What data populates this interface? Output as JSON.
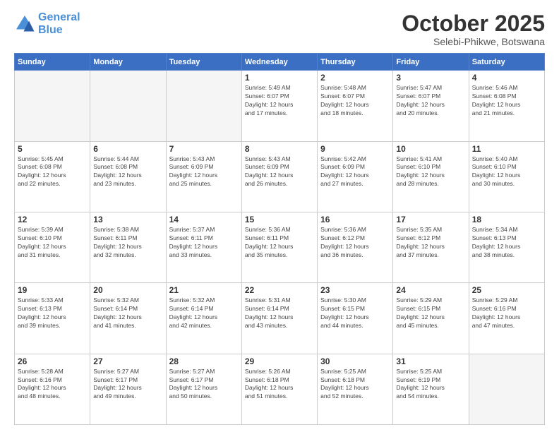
{
  "logo": {
    "line1": "General",
    "line2": "Blue"
  },
  "header": {
    "month": "October 2025",
    "location": "Selebi-Phikwe, Botswana"
  },
  "weekdays": [
    "Sunday",
    "Monday",
    "Tuesday",
    "Wednesday",
    "Thursday",
    "Friday",
    "Saturday"
  ],
  "weeks": [
    [
      {
        "day": "",
        "info": ""
      },
      {
        "day": "",
        "info": ""
      },
      {
        "day": "",
        "info": ""
      },
      {
        "day": "1",
        "info": "Sunrise: 5:49 AM\nSunset: 6:07 PM\nDaylight: 12 hours\nand 17 minutes."
      },
      {
        "day": "2",
        "info": "Sunrise: 5:48 AM\nSunset: 6:07 PM\nDaylight: 12 hours\nand 18 minutes."
      },
      {
        "day": "3",
        "info": "Sunrise: 5:47 AM\nSunset: 6:07 PM\nDaylight: 12 hours\nand 20 minutes."
      },
      {
        "day": "4",
        "info": "Sunrise: 5:46 AM\nSunset: 6:08 PM\nDaylight: 12 hours\nand 21 minutes."
      }
    ],
    [
      {
        "day": "5",
        "info": "Sunrise: 5:45 AM\nSunset: 6:08 PM\nDaylight: 12 hours\nand 22 minutes."
      },
      {
        "day": "6",
        "info": "Sunrise: 5:44 AM\nSunset: 6:08 PM\nDaylight: 12 hours\nand 23 minutes."
      },
      {
        "day": "7",
        "info": "Sunrise: 5:43 AM\nSunset: 6:09 PM\nDaylight: 12 hours\nand 25 minutes."
      },
      {
        "day": "8",
        "info": "Sunrise: 5:43 AM\nSunset: 6:09 PM\nDaylight: 12 hours\nand 26 minutes."
      },
      {
        "day": "9",
        "info": "Sunrise: 5:42 AM\nSunset: 6:09 PM\nDaylight: 12 hours\nand 27 minutes."
      },
      {
        "day": "10",
        "info": "Sunrise: 5:41 AM\nSunset: 6:10 PM\nDaylight: 12 hours\nand 28 minutes."
      },
      {
        "day": "11",
        "info": "Sunrise: 5:40 AM\nSunset: 6:10 PM\nDaylight: 12 hours\nand 30 minutes."
      }
    ],
    [
      {
        "day": "12",
        "info": "Sunrise: 5:39 AM\nSunset: 6:10 PM\nDaylight: 12 hours\nand 31 minutes."
      },
      {
        "day": "13",
        "info": "Sunrise: 5:38 AM\nSunset: 6:11 PM\nDaylight: 12 hours\nand 32 minutes."
      },
      {
        "day": "14",
        "info": "Sunrise: 5:37 AM\nSunset: 6:11 PM\nDaylight: 12 hours\nand 33 minutes."
      },
      {
        "day": "15",
        "info": "Sunrise: 5:36 AM\nSunset: 6:11 PM\nDaylight: 12 hours\nand 35 minutes."
      },
      {
        "day": "16",
        "info": "Sunrise: 5:36 AM\nSunset: 6:12 PM\nDaylight: 12 hours\nand 36 minutes."
      },
      {
        "day": "17",
        "info": "Sunrise: 5:35 AM\nSunset: 6:12 PM\nDaylight: 12 hours\nand 37 minutes."
      },
      {
        "day": "18",
        "info": "Sunrise: 5:34 AM\nSunset: 6:13 PM\nDaylight: 12 hours\nand 38 minutes."
      }
    ],
    [
      {
        "day": "19",
        "info": "Sunrise: 5:33 AM\nSunset: 6:13 PM\nDaylight: 12 hours\nand 39 minutes."
      },
      {
        "day": "20",
        "info": "Sunrise: 5:32 AM\nSunset: 6:14 PM\nDaylight: 12 hours\nand 41 minutes."
      },
      {
        "day": "21",
        "info": "Sunrise: 5:32 AM\nSunset: 6:14 PM\nDaylight: 12 hours\nand 42 minutes."
      },
      {
        "day": "22",
        "info": "Sunrise: 5:31 AM\nSunset: 6:14 PM\nDaylight: 12 hours\nand 43 minutes."
      },
      {
        "day": "23",
        "info": "Sunrise: 5:30 AM\nSunset: 6:15 PM\nDaylight: 12 hours\nand 44 minutes."
      },
      {
        "day": "24",
        "info": "Sunrise: 5:29 AM\nSunset: 6:15 PM\nDaylight: 12 hours\nand 45 minutes."
      },
      {
        "day": "25",
        "info": "Sunrise: 5:29 AM\nSunset: 6:16 PM\nDaylight: 12 hours\nand 47 minutes."
      }
    ],
    [
      {
        "day": "26",
        "info": "Sunrise: 5:28 AM\nSunset: 6:16 PM\nDaylight: 12 hours\nand 48 minutes."
      },
      {
        "day": "27",
        "info": "Sunrise: 5:27 AM\nSunset: 6:17 PM\nDaylight: 12 hours\nand 49 minutes."
      },
      {
        "day": "28",
        "info": "Sunrise: 5:27 AM\nSunset: 6:17 PM\nDaylight: 12 hours\nand 50 minutes."
      },
      {
        "day": "29",
        "info": "Sunrise: 5:26 AM\nSunset: 6:18 PM\nDaylight: 12 hours\nand 51 minutes."
      },
      {
        "day": "30",
        "info": "Sunrise: 5:25 AM\nSunset: 6:18 PM\nDaylight: 12 hours\nand 52 minutes."
      },
      {
        "day": "31",
        "info": "Sunrise: 5:25 AM\nSunset: 6:19 PM\nDaylight: 12 hours\nand 54 minutes."
      },
      {
        "day": "",
        "info": ""
      }
    ]
  ]
}
